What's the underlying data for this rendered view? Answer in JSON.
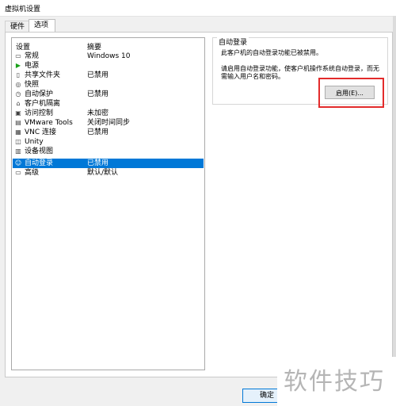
{
  "window": {
    "title": "虚拟机设置"
  },
  "tabs": [
    {
      "label": "硬件",
      "active": false
    },
    {
      "label": "选项",
      "active": true
    }
  ],
  "list": {
    "col_setting": "设置",
    "col_summary": "摘要",
    "rows": [
      {
        "name": "常规",
        "summary": "Windows 10",
        "icon": "general-icon"
      },
      {
        "name": "电源",
        "summary": "",
        "icon": "power-icon"
      },
      {
        "name": "共享文件夹",
        "summary": "已禁用",
        "icon": "shared-folder-icon"
      },
      {
        "name": "快照",
        "summary": "",
        "icon": "snapshot-icon"
      },
      {
        "name": "自动保护",
        "summary": "已禁用",
        "icon": "autoprotect-icon"
      },
      {
        "name": "客户机隔离",
        "summary": "",
        "icon": "lock-icon"
      },
      {
        "name": "访问控制",
        "summary": "未加密",
        "icon": "access-control-icon"
      },
      {
        "name": "VMware Tools",
        "summary": "关闭时间同步",
        "icon": "vmware-tools-icon"
      },
      {
        "name": "VNC 连接",
        "summary": "已禁用",
        "icon": "vnc-icon"
      },
      {
        "name": "Unity",
        "summary": "",
        "icon": "unity-icon"
      },
      {
        "name": "设备视图",
        "summary": "",
        "icon": "device-view-icon"
      },
      {
        "name": "自动登录",
        "summary": "已禁用",
        "icon": "user-icon",
        "selected": true
      },
      {
        "name": "高级",
        "summary": "默认/默认",
        "icon": "advanced-icon"
      }
    ]
  },
  "autologin": {
    "group_title": "自动登录",
    "status_text": "此客户机的自动登录功能已被禁用。",
    "desc_text": "请启用自动登录功能，使客户机操作系统自动登录，而无需输入用户名和密码。",
    "enable_label": "启用(E)..."
  },
  "footer": {
    "ok_label": "确定"
  },
  "watermark": {
    "text": "软件技巧"
  },
  "colors": {
    "selection": "#0078d7",
    "highlight": "#e32b2b"
  }
}
